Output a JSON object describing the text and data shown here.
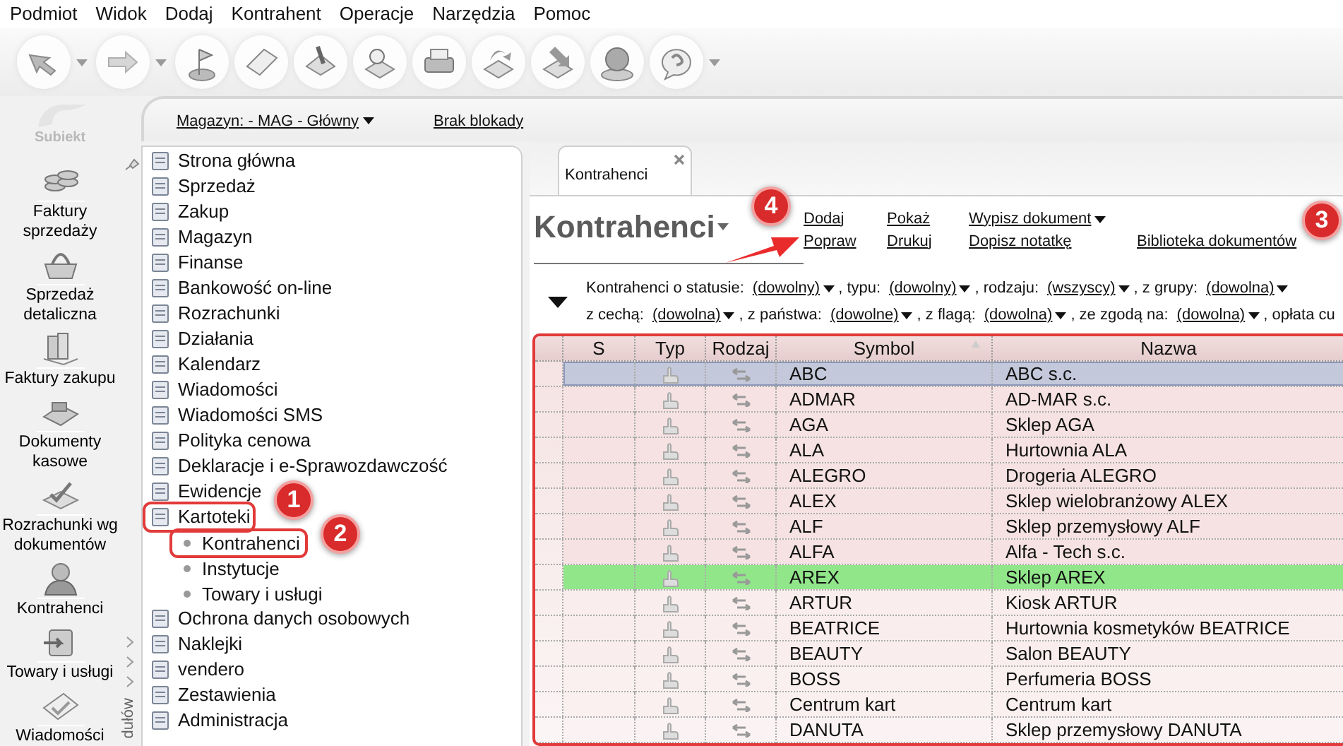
{
  "menu": [
    "Podmiot",
    "Widok",
    "Dodaj",
    "Kontrahent",
    "Operacje",
    "Narzędzia",
    "Pomoc"
  ],
  "logo": {
    "text": "Subiekt"
  },
  "nav": [
    {
      "lines": [
        "Faktury",
        "sprzedaży"
      ]
    },
    {
      "lines": [
        "Sprzedaż",
        "detaliczna"
      ]
    },
    {
      "lines": [
        "Faktury zakupu"
      ]
    },
    {
      "lines": [
        "Dokumenty",
        "kasowe"
      ]
    },
    {
      "lines": [
        "Rozrachunki wg",
        "dokumentów"
      ]
    },
    {
      "lines": [
        "Kontrahenci"
      ]
    },
    {
      "lines": [
        "Towary i usługi"
      ]
    },
    {
      "lines": [
        "Wiadomości"
      ]
    }
  ],
  "store_bar": {
    "warehouse": "Magazyn: - MAG - Główny",
    "lock": "Brak blokady"
  },
  "side_label": "dułów",
  "tree": [
    {
      "label": "Strona główna",
      "highlighted": false
    },
    {
      "label": "Sprzedaż",
      "highlighted": false
    },
    {
      "label": "Zakup",
      "highlighted": false
    },
    {
      "label": "Magazyn",
      "highlighted": false
    },
    {
      "label": "Finanse",
      "highlighted": false
    },
    {
      "label": "Bankowość on-line",
      "highlighted": false
    },
    {
      "label": "Rozrachunki",
      "highlighted": false
    },
    {
      "label": "Działania",
      "highlighted": false
    },
    {
      "label": "Kalendarz",
      "highlighted": false
    },
    {
      "label": "Wiadomości",
      "highlighted": false
    },
    {
      "label": "Wiadomości SMS",
      "highlighted": false
    },
    {
      "label": "Polityka cenowa",
      "highlighted": false
    },
    {
      "label": "Deklaracje i e-Sprawozdawczość",
      "highlighted": false
    },
    {
      "label": "Ewidencje",
      "highlighted": false
    },
    {
      "label": "Kartoteki",
      "highlighted": true,
      "children": [
        {
          "label": "Kontrahenci",
          "highlighted": true
        },
        {
          "label": "Instytucje",
          "highlighted": false
        },
        {
          "label": "Towary i usługi",
          "highlighted": false
        }
      ]
    },
    {
      "label": "Ochrona danych osobowych",
      "highlighted": false
    },
    {
      "label": "Naklejki",
      "highlighted": false
    },
    {
      "label": "vendero",
      "highlighted": false
    },
    {
      "label": "Zestawienia",
      "highlighted": false
    },
    {
      "label": "Administracja",
      "highlighted": false
    }
  ],
  "tab": {
    "label": "Kontrahenci"
  },
  "title": "Kontrahenci",
  "action_rows": [
    [
      {
        "label": "Dodaj",
        "dropdown": false
      },
      {
        "label": "Pokaż",
        "dropdown": false
      },
      {
        "label": "Wypisz dokument",
        "dropdown": true
      }
    ],
    [
      {
        "label": "Popraw",
        "dropdown": false
      },
      {
        "label": "Drukuj",
        "dropdown": false
      },
      {
        "label": "Dopisz notatkę",
        "dropdown": false
      },
      {
        "label": "Biblioteka dokumentów",
        "dropdown": false
      }
    ]
  ],
  "filters": [
    [
      {
        "label": "Kontrahenci o statusie:",
        "value": "(dowolny)"
      },
      {
        "label": ", typu:",
        "value": "(dowolny)"
      },
      {
        "label": ", rodzaju:",
        "value": "(wszyscy)"
      },
      {
        "label": ", z grupy:",
        "value": "(dowolna)"
      }
    ],
    [
      {
        "label": "z cechą:",
        "value": "(dowolna)"
      },
      {
        "label": ", z państwa:",
        "value": "(dowolne)"
      },
      {
        "label": ", z flagą:",
        "value": "(dowolna)"
      },
      {
        "label": ", ze zgodą na:",
        "value": "(dowolna)"
      },
      {
        "label": ", opłata cu"
      }
    ]
  ],
  "table": {
    "highlighted": true,
    "columns": [
      {
        "label": "S",
        "sorted": false
      },
      {
        "label": "Typ",
        "sorted": false
      },
      {
        "label": "Rodzaj",
        "sorted": false
      },
      {
        "label": "Symbol",
        "sorted": true
      },
      {
        "label": "Nazwa",
        "sorted": false
      }
    ],
    "rows": [
      {
        "symbol": "ABC",
        "name": "ABC s.c.",
        "selected": true,
        "color": "#c3c8da"
      },
      {
        "symbol": "ADMAR",
        "name": "AD-MAR s.c.",
        "selected": false,
        "color": "#f6e2e2"
      },
      {
        "symbol": "AGA",
        "name": "Sklep AGA",
        "selected": false,
        "color": "#f6e2e2"
      },
      {
        "symbol": "ALA",
        "name": "Hurtownia ALA",
        "selected": false,
        "color": "#f6e2e2"
      },
      {
        "symbol": "ALEGRO",
        "name": "Drogeria ALEGRO",
        "selected": false,
        "color": "#f6e2e2"
      },
      {
        "symbol": "ALEX",
        "name": "Sklep wielobranżowy  ALEX",
        "selected": false,
        "color": "#f6e2e2"
      },
      {
        "symbol": "ALF",
        "name": "Sklep przemysłowy ALF",
        "selected": false,
        "color": "#f6e2e2"
      },
      {
        "symbol": "ALFA",
        "name": "Alfa - Tech s.c.",
        "selected": false,
        "color": "#f6e2e2"
      },
      {
        "symbol": "AREX",
        "name": "Sklep AREX",
        "selected": false,
        "color": "#92e68a"
      },
      {
        "symbol": "ARTUR",
        "name": "Kiosk ARTUR",
        "selected": false,
        "color": "#f9eded"
      },
      {
        "symbol": "BEATRICE",
        "name": "Hurtownia kosmetyków BEATRICE",
        "selected": false,
        "color": "#f9eded"
      },
      {
        "symbol": "BEAUTY",
        "name": "Salon BEAUTY",
        "selected": false,
        "color": "#f9eded"
      },
      {
        "symbol": "BOSS",
        "name": "Perfumeria BOSS",
        "selected": false,
        "color": "#faf0f0"
      },
      {
        "symbol": "Centrum kart",
        "name": "Centrum kart",
        "selected": false,
        "color": "#faf0f0"
      },
      {
        "symbol": "DANUTA",
        "name": "Sklep przemysłowy DANUTA",
        "selected": false,
        "color": "#fbf3f3"
      }
    ]
  },
  "annotations": [
    {
      "label": "1"
    },
    {
      "label": "2"
    },
    {
      "label": "3"
    },
    {
      "label": "4"
    }
  ]
}
